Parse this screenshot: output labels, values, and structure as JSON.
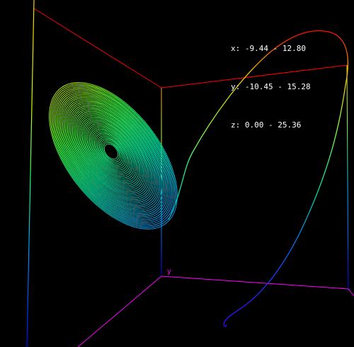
{
  "range_readout": [
    {
      "axis": "x",
      "text": "x: -9.44 - 12.80"
    },
    {
      "axis": "y",
      "text": "y: -10.45 - 15.28"
    },
    {
      "axis": "z",
      "text": "z: 0.00 - 25.36"
    }
  ],
  "axis_label_y": "y",
  "bounds": {
    "x": [
      -9.44,
      12.8
    ],
    "y": [
      -10.45,
      15.28
    ],
    "z": [
      0.0,
      25.36
    ]
  },
  "colors": {
    "background": "#000000",
    "readout_text": "#ffffff",
    "floor_frame": "#ff00ff",
    "back_frame": "#ff0000",
    "gradient": [
      "#0000ff",
      "#00bfff",
      "#00ff80",
      "#ffff00",
      "#ff0000"
    ]
  }
}
